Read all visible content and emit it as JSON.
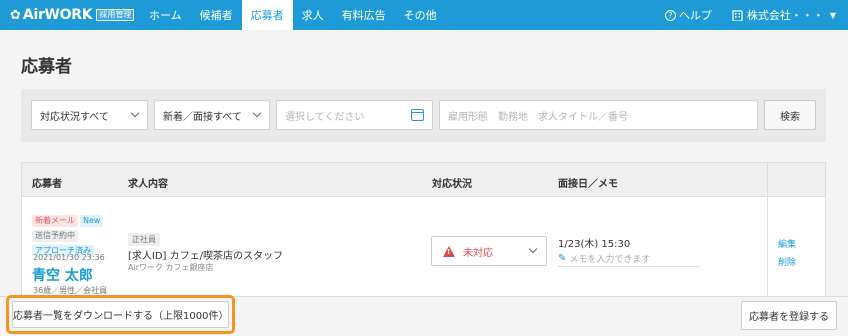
{
  "header": {
    "logo_mark": "✿",
    "logo_text": "AirWORK",
    "logo_badge": "採用管理",
    "nav": [
      "ホーム",
      "候補者",
      "応募者",
      "求人",
      "有料広告",
      "その他"
    ],
    "active_nav": "応募者",
    "help_label": "ヘルプ",
    "company_label": "株式会社・・・"
  },
  "page": {
    "title": "応募者"
  },
  "filters": {
    "status_value": "対応状況すべて",
    "type_value": "新着／面接すべて",
    "date_placeholder": "選択してください",
    "keyword_placeholder": "雇用形態　勤務地　求人タイトル／番号",
    "search_label": "検索"
  },
  "table": {
    "headers": {
      "applicant": "応募者",
      "job": "求人内容",
      "status": "対応状況",
      "interview": "面接日／メモ"
    },
    "row": {
      "tags1": [
        "新着メール",
        "New"
      ],
      "tags2": [
        "送信予約中"
      ],
      "tags3": [
        "アプローチ済み"
      ],
      "date": "2021/01/30 23:36",
      "name": "青空 太郎",
      "meta": "36歳／男性／会社員",
      "job_tag": "正社員",
      "job_title": "[求人ID] カフェ/喫茶店のスタッフ",
      "job_sub": "Airワーク カフェ銀座店",
      "status": "未対応",
      "interview_date": "1/23(木) 15:30",
      "memo_placeholder": "メモを入力できます",
      "edit_label": "編集",
      "delete_label": "削除"
    }
  },
  "footer": {
    "download_label": "応募者一覧をダウンロードする（上限1000件）",
    "register_label": "応募者を登録する"
  },
  "colors": {
    "brand": "#1e9bd7",
    "highlight": "#f7931e",
    "alert": "#e04a4a"
  }
}
